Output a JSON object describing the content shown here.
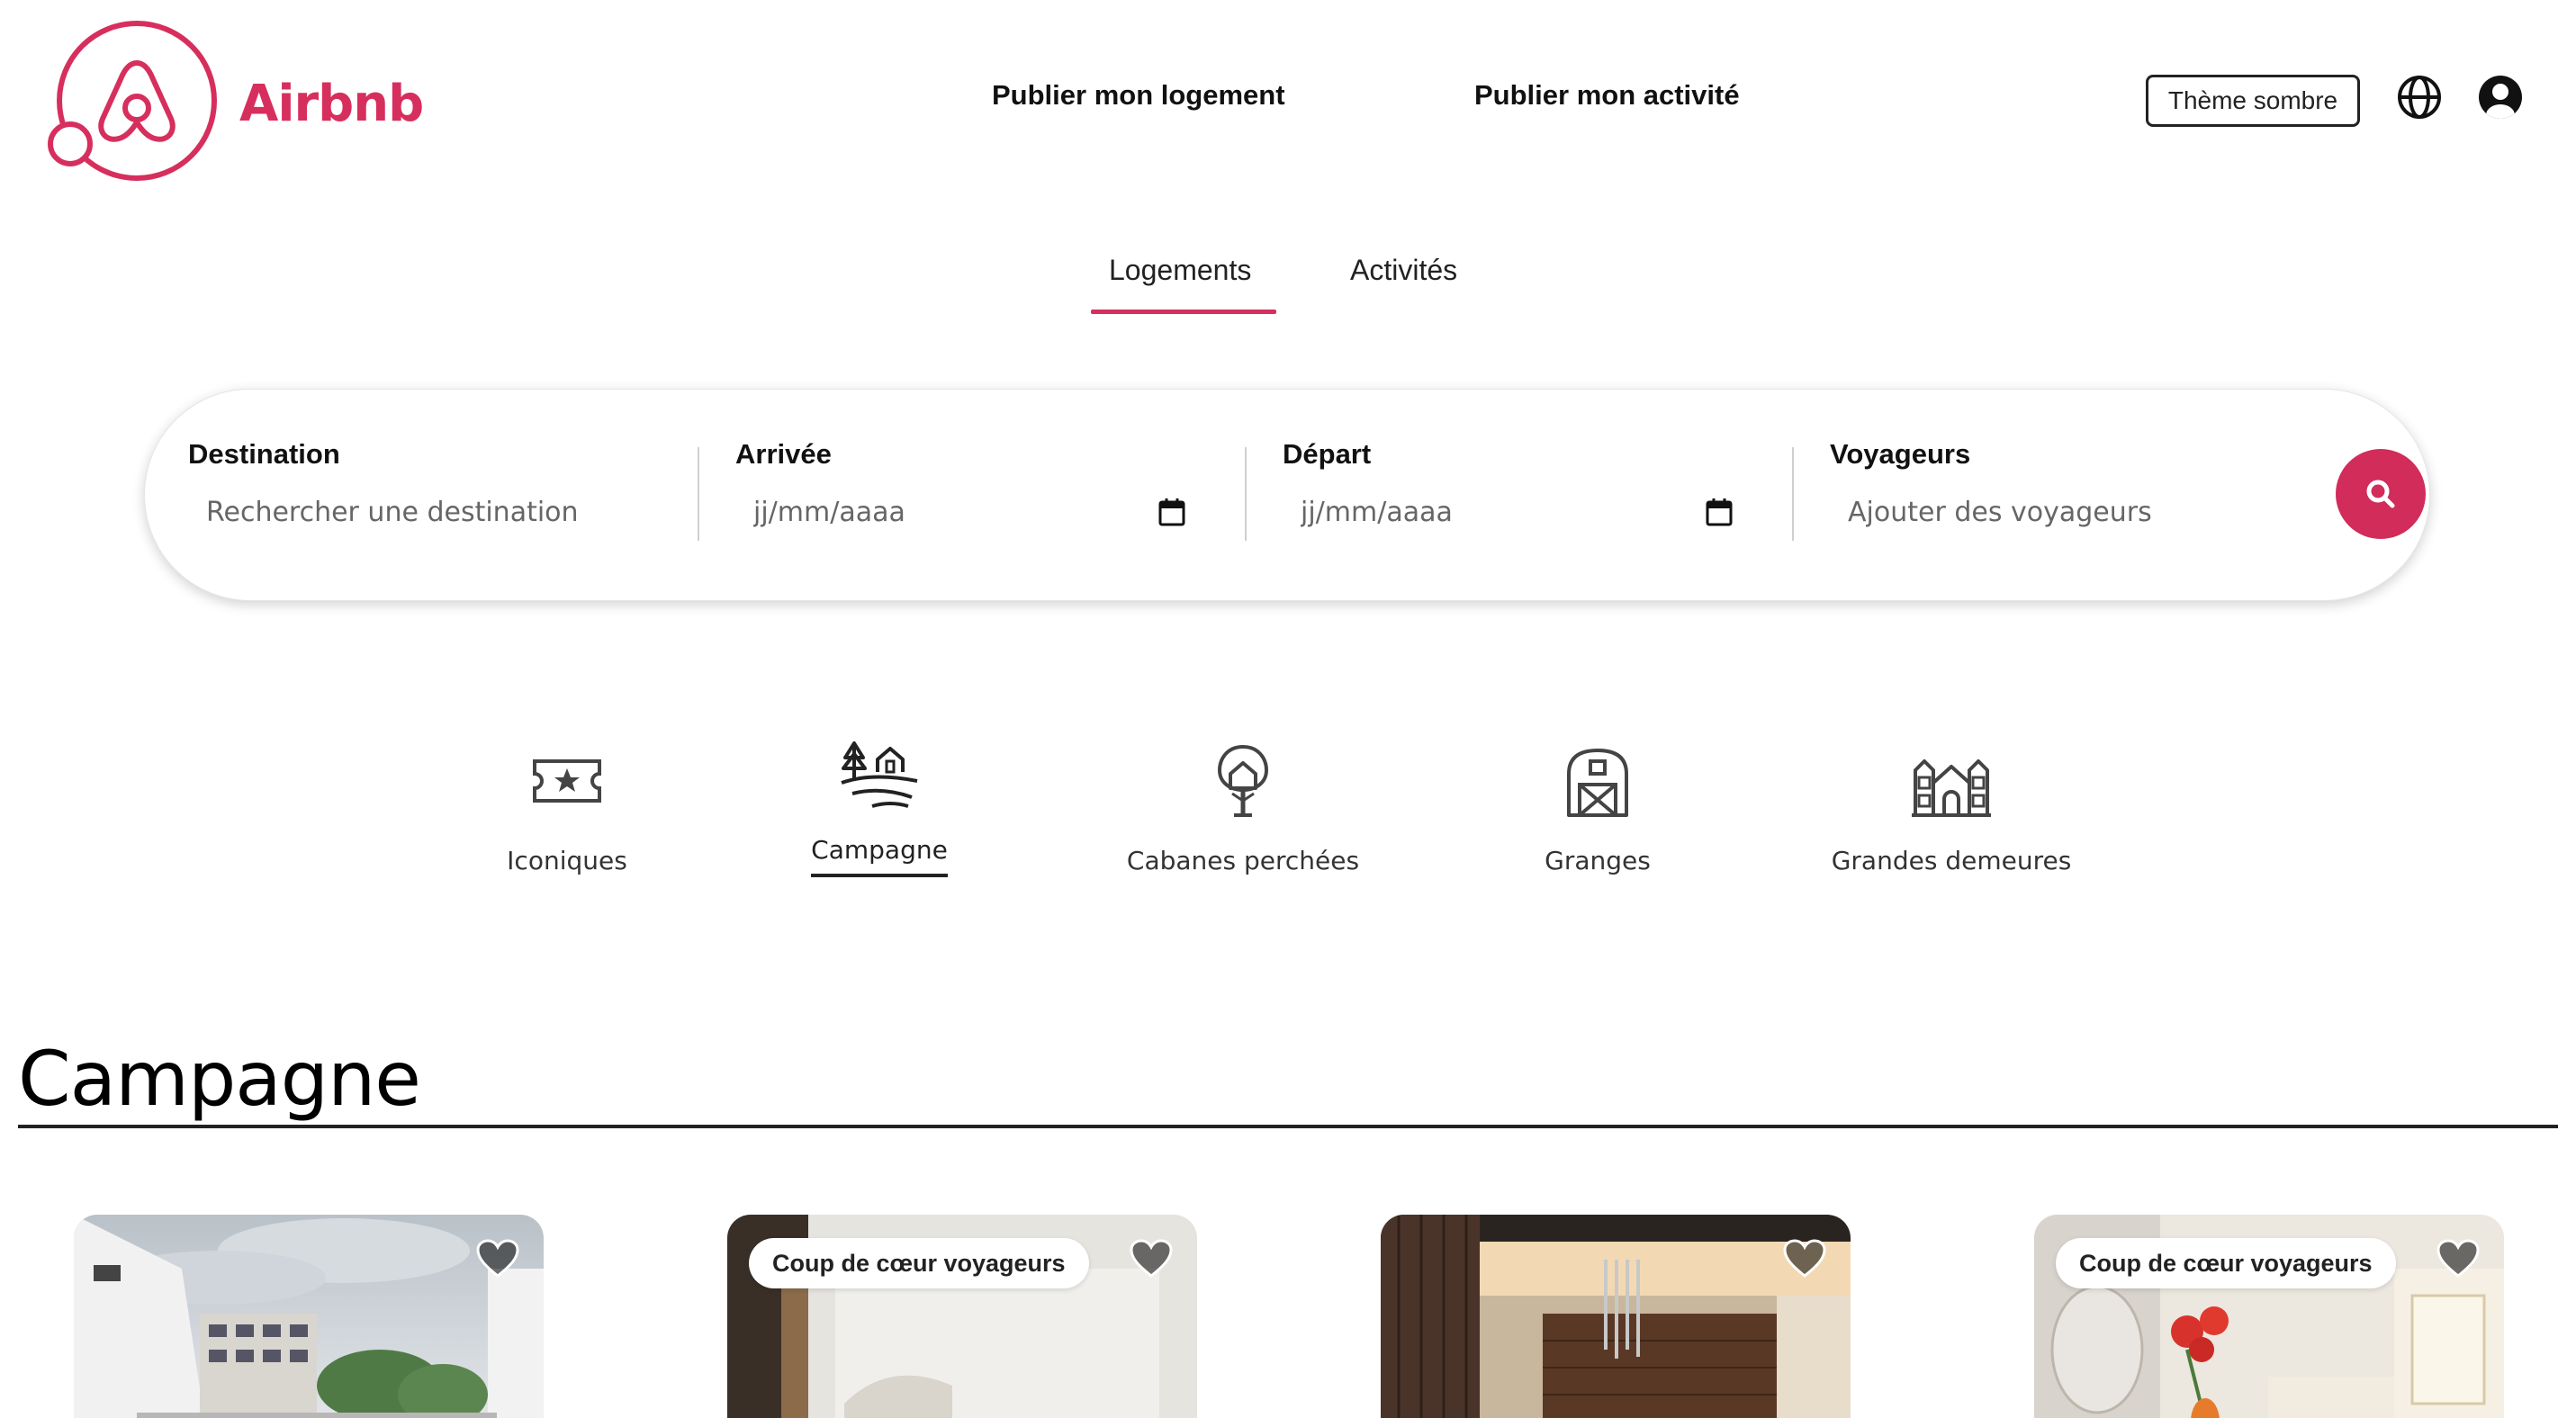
{
  "brand": {
    "name": "Airbnb",
    "color": "#D72F5D"
  },
  "header": {
    "host_link": "Publier mon logement",
    "experience_link": "Publier mon activité",
    "theme_button": "Thème sombre",
    "icons": [
      "globe-icon",
      "user-profile-icon"
    ]
  },
  "tabs": {
    "items": [
      "Logements",
      "Activités"
    ],
    "active": "Logements"
  },
  "search": {
    "destination": {
      "label": "Destination",
      "placeholder": "Rechercher une destination"
    },
    "arrival": {
      "label": "Arrivée",
      "placeholder": "jj/mm/aaaa"
    },
    "departure": {
      "label": "Départ",
      "placeholder": "jj/mm/aaaa"
    },
    "guests": {
      "label": "Voyageurs",
      "placeholder": "Ajouter des voyageurs"
    },
    "button_icon": "search-icon",
    "button_color": "#D12C5A"
  },
  "categories": {
    "items": [
      {
        "label": "Iconiques",
        "icon": "iconic-ticket-icon"
      },
      {
        "label": "Campagne",
        "icon": "countryside-icon"
      },
      {
        "label": "Cabanes perchées",
        "icon": "treehouse-icon"
      },
      {
        "label": "Granges",
        "icon": "barn-icon"
      },
      {
        "label": "Grandes demeures",
        "icon": "mansion-icon"
      }
    ],
    "active": "Campagne"
  },
  "section": {
    "title": "Campagne"
  },
  "listings": [
    {
      "badge": ""
    },
    {
      "badge": "Coup de cœur voyageurs"
    },
    {
      "badge": ""
    },
    {
      "badge": "Coup de cœur voyageurs"
    }
  ]
}
